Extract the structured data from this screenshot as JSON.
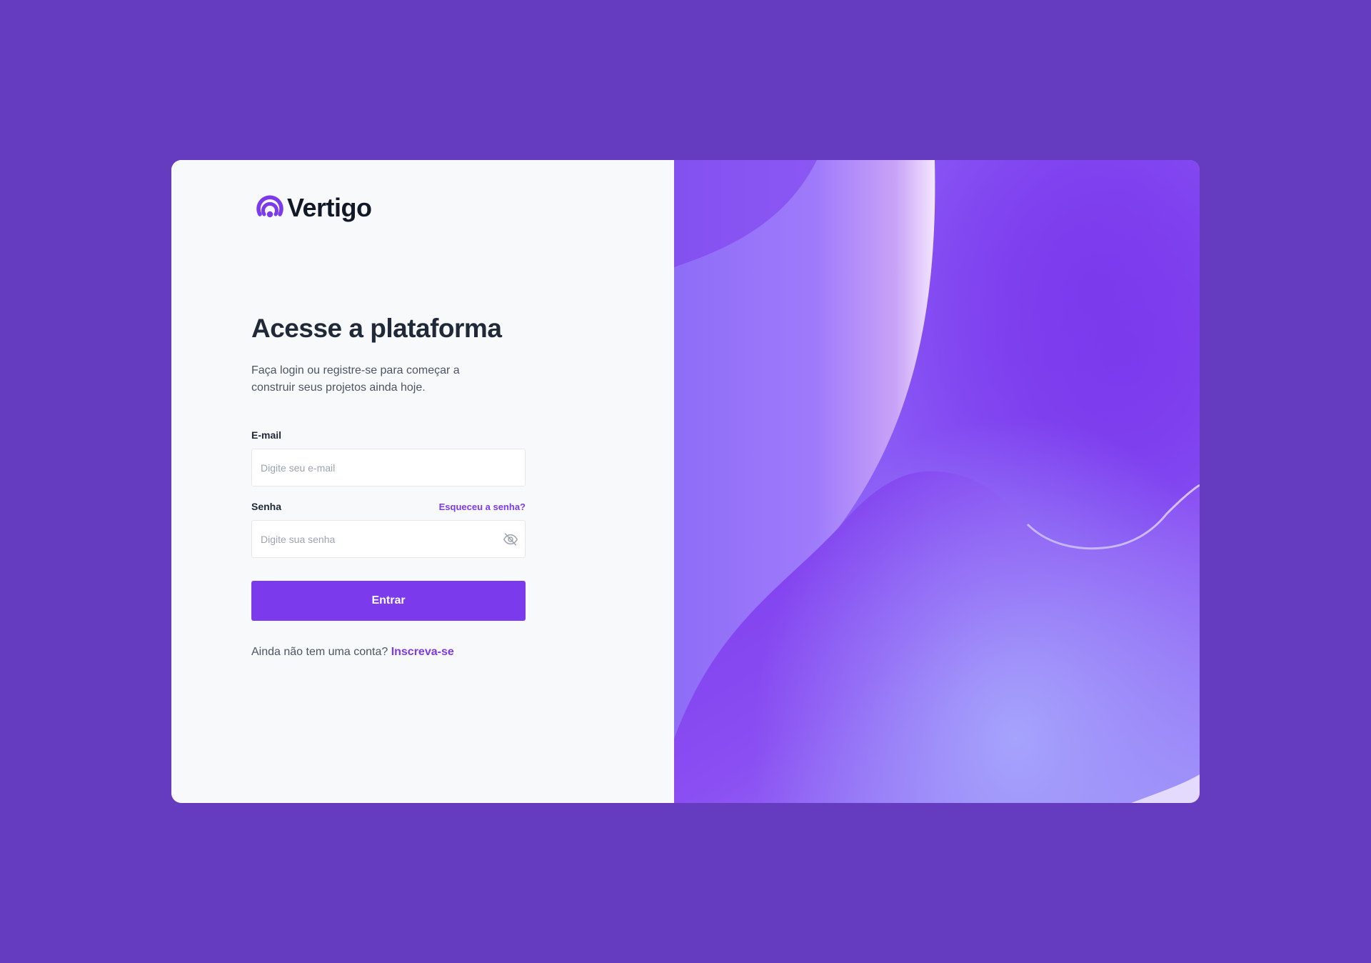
{
  "brand": {
    "name": "Vertigo",
    "logo_icon": "target-logo-icon",
    "accent_color": "#7c3aed"
  },
  "login": {
    "title": "Acesse a plataforma",
    "subtitle": "Faça login ou registre-se para começar a construir seus projetos ainda hoje.",
    "email": {
      "label": "E-mail",
      "placeholder": "Digite seu e-mail",
      "value": ""
    },
    "password": {
      "label": "Senha",
      "placeholder": "Digite sua senha",
      "value": "",
      "forgot_label": "Esqueceu a senha?",
      "toggle_icon": "eye-off-icon"
    },
    "submit_label": "Entrar",
    "signup_prompt": "Ainda não tem uma conta?",
    "signup_link": "Inscreva-se"
  },
  "colors": {
    "page_background": "#653bbf",
    "card_left": "#f8f9fb",
    "hero": "#7c3aed"
  }
}
